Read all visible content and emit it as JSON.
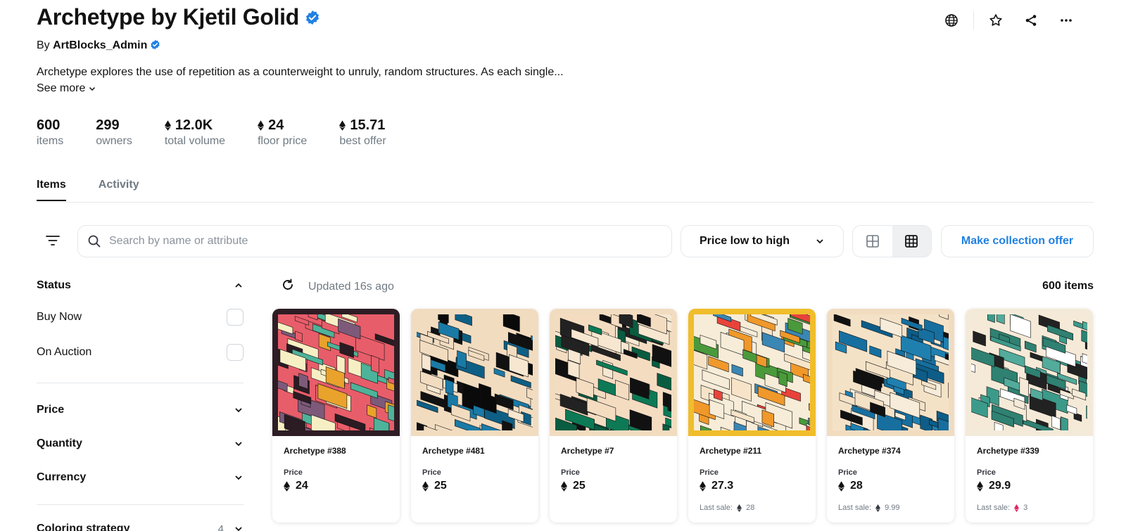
{
  "collection": {
    "title": "Archetype by Kjetil Golid",
    "by_prefix": "By",
    "creator": "ArtBlocks_Admin",
    "description": "Archetype explores the use of repetition as a counterweight to unruly, random structures. As each single...",
    "see_more": "See more"
  },
  "stats": [
    {
      "value": "600",
      "label": "items",
      "eth": false
    },
    {
      "value": "299",
      "label": "owners",
      "eth": false
    },
    {
      "value": "12.0K",
      "label": "total volume",
      "eth": true
    },
    {
      "value": "24",
      "label": "floor price",
      "eth": true
    },
    {
      "value": "15.71",
      "label": "best offer",
      "eth": true
    }
  ],
  "header_icons": [
    "globe-icon",
    "star-icon",
    "share-icon",
    "more-icon"
  ],
  "tabs": [
    {
      "label": "Items",
      "active": true
    },
    {
      "label": "Activity",
      "active": false
    }
  ],
  "toolbar": {
    "search_placeholder": "Search by name or attribute",
    "sort_label": "Price low to high",
    "offer_button": "Make collection offer"
  },
  "sidebar": {
    "status": {
      "label": "Status",
      "options": [
        "Buy Now",
        "On Auction"
      ]
    },
    "price": "Price",
    "quantity": "Quantity",
    "currency": "Currency",
    "coloring": {
      "label": "Coloring strategy",
      "count": "4"
    }
  },
  "results": {
    "updated": "Updated 16s ago",
    "count": "600 items"
  },
  "price_label": "Price",
  "last_sale_label": "Last sale:",
  "cards": [
    {
      "name": "Archetype #388",
      "price": "24",
      "last_sale": "",
      "frame": "#2e1d24",
      "palette": [
        "#e9a22b",
        "#e85d6a",
        "#f7efc4",
        "#2b1b22",
        "#4db39a",
        "#7d5a7a"
      ]
    },
    {
      "name": "Archetype #481",
      "price": "25",
      "last_sale": "",
      "frame": "#f2dcc0",
      "palette": [
        "#1a7aa6",
        "#f2dcc0",
        "#111111",
        "#0e5f85",
        "#f7e7d0",
        "#0a0a0a"
      ]
    },
    {
      "name": "Archetype #7",
      "price": "25",
      "last_sale": "",
      "frame": "#f2dcc0",
      "palette": [
        "#0d7a55",
        "#f4dcc1",
        "#111111",
        "#f7e7d0",
        "#095c40",
        "#222222"
      ]
    },
    {
      "name": "Archetype #211",
      "price": "27.3",
      "last_sale": "28",
      "last_sale_currency": "eth",
      "frame": "#f0bd2b",
      "palette": [
        "#e8433b",
        "#f6ecd8",
        "#f0982a",
        "#f7e4c8",
        "#4a9a3b",
        "#3a86b4"
      ]
    },
    {
      "name": "Archetype #374",
      "price": "28",
      "last_sale": "9.99",
      "last_sale_currency": "eth",
      "frame": "#f2dcc0",
      "palette": [
        "#166f9f",
        "#f4e2c7",
        "#111111",
        "#0d5d88",
        "#f7ecd9",
        "#1f80b0"
      ]
    },
    {
      "name": "Archetype #339",
      "price": "29.9",
      "last_sale": "3",
      "last_sale_currency": "weth",
      "frame": "#f4ead9",
      "palette": [
        "#3c9a8a",
        "#f5ead7",
        "#222222",
        "#2f8172",
        "#ffffff",
        "#52ab9b"
      ]
    }
  ]
}
